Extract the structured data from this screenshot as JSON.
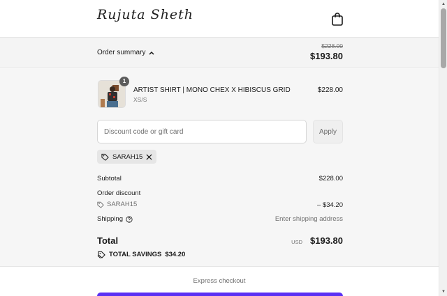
{
  "brand": {
    "logo_text": "Rujuta Sheth"
  },
  "summary_bar": {
    "toggle_label": "Order summary",
    "original_price": "$228.00",
    "current_price": "$193.80"
  },
  "product": {
    "name": "ARTIST SHIRT | MONO CHEX X HIBISCUS GRID",
    "variant": "XS/S",
    "price": "$228.00",
    "quantity": "1"
  },
  "discount": {
    "placeholder": "Discount code or gift card",
    "apply_label": "Apply",
    "applied_code": "SARAH15"
  },
  "totals": {
    "subtotal_label": "Subtotal",
    "subtotal_value": "$228.00",
    "order_discount_label": "Order discount",
    "discount_code": "SARAH15",
    "discount_value": "– $34.20",
    "shipping_label": "Shipping",
    "shipping_value": "Enter shipping address",
    "total_label": "Total",
    "currency": "USD",
    "total_value": "$193.80",
    "savings_label": "TOTAL SAVINGS",
    "savings_value": "$34.20"
  },
  "express": {
    "label": "Express checkout"
  },
  "colors": {
    "accent": "#5a31f4",
    "summary_bg": "#f4f4f4"
  },
  "icons": [
    "shopping-bag-icon",
    "chevron-up-icon",
    "tag-icon",
    "close-icon",
    "help-circle-icon"
  ]
}
